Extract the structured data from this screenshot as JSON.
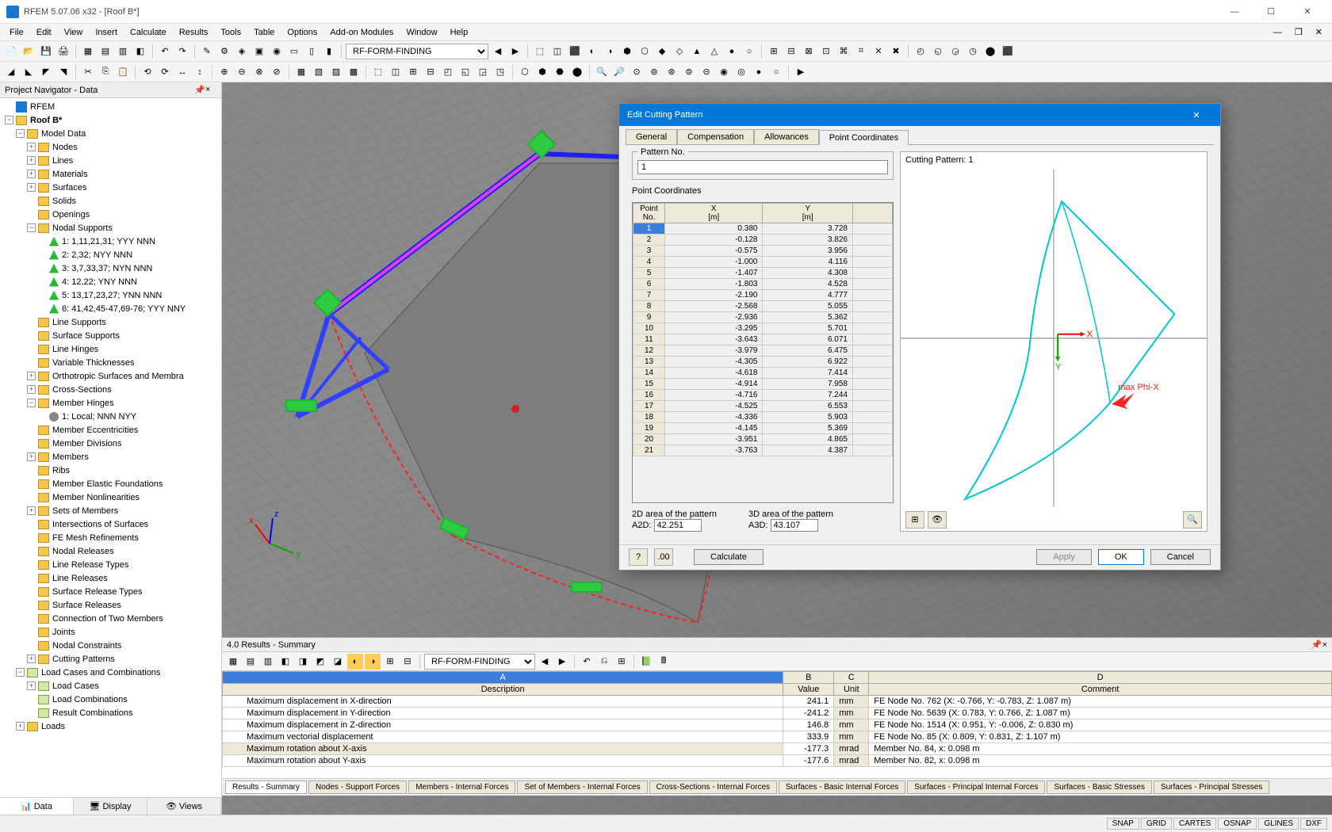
{
  "app": {
    "title": "RFEM 5.07.06 x32 - [Roof B*]"
  },
  "menu": [
    "File",
    "Edit",
    "View",
    "Insert",
    "Calculate",
    "Results",
    "Tools",
    "Table",
    "Options",
    "Add-on Modules",
    "Window",
    "Help"
  ],
  "toolbar_combo": "RF-FORM-FINDING",
  "navigator": {
    "title": "Project Navigator - Data",
    "root": "RFEM",
    "model": "Roof B*",
    "tabs": [
      "Data",
      "Display",
      "Views"
    ]
  },
  "tree": [
    {
      "l": 1,
      "exp": "-",
      "t": "Model Data",
      "folder": 1
    },
    {
      "l": 2,
      "exp": "+",
      "t": "Nodes",
      "folder": 1
    },
    {
      "l": 2,
      "exp": "+",
      "t": "Lines",
      "folder": 1
    },
    {
      "l": 2,
      "exp": "+",
      "t": "Materials",
      "folder": 1
    },
    {
      "l": 2,
      "exp": "+",
      "t": "Surfaces",
      "folder": 1
    },
    {
      "l": 2,
      "exp": "",
      "t": "Solids",
      "folder": 1
    },
    {
      "l": 2,
      "exp": "",
      "t": "Openings",
      "folder": 1
    },
    {
      "l": 2,
      "exp": "-",
      "t": "Nodal Supports",
      "folder": 1
    },
    {
      "l": 3,
      "exp": "",
      "t": "1: 1,11,21,31; YYY NNN",
      "icon": "support"
    },
    {
      "l": 3,
      "exp": "",
      "t": "2: 2,32; NYY NNN",
      "icon": "support"
    },
    {
      "l": 3,
      "exp": "",
      "t": "3: 3,7,33,37; NYN NNN",
      "icon": "support"
    },
    {
      "l": 3,
      "exp": "",
      "t": "4: 12,22; YNY NNN",
      "icon": "support"
    },
    {
      "l": 3,
      "exp": "",
      "t": "5: 13,17,23,27; YNN NNN",
      "icon": "support"
    },
    {
      "l": 3,
      "exp": "",
      "t": "6: 41,42,45-47,69-76; YYY NNY",
      "icon": "support"
    },
    {
      "l": 2,
      "exp": "",
      "t": "Line Supports",
      "folder": 1
    },
    {
      "l": 2,
      "exp": "",
      "t": "Surface Supports",
      "folder": 1
    },
    {
      "l": 2,
      "exp": "",
      "t": "Line Hinges",
      "folder": 1
    },
    {
      "l": 2,
      "exp": "",
      "t": "Variable Thicknesses",
      "folder": 1
    },
    {
      "l": 2,
      "exp": "+",
      "t": "Orthotropic Surfaces and Membra",
      "folder": 1
    },
    {
      "l": 2,
      "exp": "+",
      "t": "Cross-Sections",
      "folder": 1
    },
    {
      "l": 2,
      "exp": "-",
      "t": "Member Hinges",
      "folder": 1
    },
    {
      "l": 3,
      "exp": "",
      "t": "1: Local; NNN NYY",
      "icon": "hinge"
    },
    {
      "l": 2,
      "exp": "",
      "t": "Member Eccentricities",
      "folder": 1
    },
    {
      "l": 2,
      "exp": "",
      "t": "Member Divisions",
      "folder": 1
    },
    {
      "l": 2,
      "exp": "+",
      "t": "Members",
      "folder": 1
    },
    {
      "l": 2,
      "exp": "",
      "t": "Ribs",
      "folder": 1
    },
    {
      "l": 2,
      "exp": "",
      "t": "Member Elastic Foundations",
      "folder": 1
    },
    {
      "l": 2,
      "exp": "",
      "t": "Member Nonlinearities",
      "folder": 1
    },
    {
      "l": 2,
      "exp": "+",
      "t": "Sets of Members",
      "folder": 1
    },
    {
      "l": 2,
      "exp": "",
      "t": "Intersections of Surfaces",
      "folder": 1
    },
    {
      "l": 2,
      "exp": "",
      "t": "FE Mesh Refinements",
      "folder": 1
    },
    {
      "l": 2,
      "exp": "",
      "t": "Nodal Releases",
      "folder": 1
    },
    {
      "l": 2,
      "exp": "",
      "t": "Line Release Types",
      "folder": 1
    },
    {
      "l": 2,
      "exp": "",
      "t": "Line Releases",
      "folder": 1
    },
    {
      "l": 2,
      "exp": "",
      "t": "Surface Release Types",
      "folder": 1
    },
    {
      "l": 2,
      "exp": "",
      "t": "Surface Releases",
      "folder": 1
    },
    {
      "l": 2,
      "exp": "",
      "t": "Connection of Two Members",
      "folder": 1
    },
    {
      "l": 2,
      "exp": "",
      "t": "Joints",
      "folder": 1
    },
    {
      "l": 2,
      "exp": "",
      "t": "Nodal Constraints",
      "folder": 1
    },
    {
      "l": 2,
      "exp": "+",
      "t": "Cutting Patterns",
      "folder": 1
    },
    {
      "l": 1,
      "exp": "-",
      "t": "Load Cases and Combinations",
      "folder": 1,
      "special": 1
    },
    {
      "l": 2,
      "exp": "+",
      "t": "Load Cases",
      "folder": 1,
      "special": 1
    },
    {
      "l": 2,
      "exp": "",
      "t": "Load Combinations",
      "folder": 1,
      "special": 1
    },
    {
      "l": 2,
      "exp": "",
      "t": "Result Combinations",
      "folder": 1,
      "special": 1
    },
    {
      "l": 1,
      "exp": "+",
      "t": "Loads",
      "folder": 1
    }
  ],
  "results": {
    "title": "4.0 Results - Summary",
    "combo": "RF-FORM-FINDING",
    "cols": {
      "a": "A",
      "b": "B",
      "c": "C",
      "d": "D"
    },
    "headers": {
      "desc": "Description",
      "val": "Value",
      "unit": "Unit",
      "comment": "Comment"
    },
    "rows": [
      {
        "desc": "Maximum displacement in X-direction",
        "val": "241.1",
        "unit": "mm",
        "comment": "FE Node No. 762 (X: -0.766,  Y: -0.783,  Z: 1.087 m)"
      },
      {
        "desc": "Maximum displacement in Y-direction",
        "val": "-241.2",
        "unit": "mm",
        "comment": "FE Node No. 5639 (X: 0.783,  Y: 0.766,  Z: 1.087 m)"
      },
      {
        "desc": "Maximum displacement in Z-direction",
        "val": "146.8",
        "unit": "mm",
        "comment": "FE Node No. 1514 (X: 0.951,  Y: -0.006,  Z: 0.830 m)"
      },
      {
        "desc": "Maximum vectorial displacement",
        "val": "333.9",
        "unit": "mm",
        "comment": "FE Node No. 85 (X: 0.809,  Y: 0.831,  Z: 1.107 m)"
      },
      {
        "desc": "Maximum rotation about X-axis",
        "val": "-177.3",
        "unit": "mrad",
        "comment": "Member No. 84,  x: 0.098 m",
        "sel": 1
      },
      {
        "desc": "Maximum rotation about Y-axis",
        "val": "-177.6",
        "unit": "mrad",
        "comment": "Member No. 82,  x: 0.098 m"
      }
    ],
    "tabs": [
      "Results - Summary",
      "Nodes - Support Forces",
      "Members - Internal Forces",
      "Set of Members - Internal Forces",
      "Cross-Sections - Internal Forces",
      "Surfaces - Basic Internal Forces",
      "Surfaces - Principal Internal Forces",
      "Surfaces - Basic Stresses",
      "Surfaces - Principal Stresses"
    ]
  },
  "status": [
    "SNAP",
    "GRID",
    "CARTES",
    "OSNAP",
    "GLINES",
    "DXF"
  ],
  "dialog": {
    "title": "Edit Cutting Pattern",
    "tabs": [
      "General",
      "Compensation",
      "Allowances",
      "Point Coordinates"
    ],
    "active_tab": 3,
    "pattern_label": "Pattern No.",
    "pattern_no": "1",
    "coords_label": "Point Coordinates",
    "col_headers": {
      "pn": "Point\nNo.",
      "x": "X\n[m]",
      "y": "Y\n[m]"
    },
    "points": [
      {
        "n": 1,
        "x": "0.380",
        "y": "3.728",
        "sel": 1
      },
      {
        "n": 2,
        "x": "-0.128",
        "y": "3.826"
      },
      {
        "n": 3,
        "x": "-0.575",
        "y": "3.956"
      },
      {
        "n": 4,
        "x": "-1.000",
        "y": "4.116"
      },
      {
        "n": 5,
        "x": "-1.407",
        "y": "4.308"
      },
      {
        "n": 6,
        "x": "-1.803",
        "y": "4.528"
      },
      {
        "n": 7,
        "x": "-2.190",
        "y": "4.777"
      },
      {
        "n": 8,
        "x": "-2.568",
        "y": "5.055"
      },
      {
        "n": 9,
        "x": "-2.936",
        "y": "5.362"
      },
      {
        "n": 10,
        "x": "-3.295",
        "y": "5.701"
      },
      {
        "n": 11,
        "x": "-3.643",
        "y": "6.071"
      },
      {
        "n": 12,
        "x": "-3.979",
        "y": "6.475"
      },
      {
        "n": 13,
        "x": "-4.305",
        "y": "6.922"
      },
      {
        "n": 14,
        "x": "-4.618",
        "y": "7.414"
      },
      {
        "n": 15,
        "x": "-4.914",
        "y": "7.958"
      },
      {
        "n": 16,
        "x": "-4.716",
        "y": "7.244"
      },
      {
        "n": 17,
        "x": "-4.525",
        "y": "6.553"
      },
      {
        "n": 18,
        "x": "-4.336",
        "y": "5.903"
      },
      {
        "n": 19,
        "x": "-4.145",
        "y": "5.369"
      },
      {
        "n": 20,
        "x": "-3.951",
        "y": "4.865"
      },
      {
        "n": 21,
        "x": "-3.763",
        "y": "4.387"
      }
    ],
    "area2d_label": "2D area of the pattern",
    "area2d_sym": "A2D:",
    "area2d": "42.251",
    "area3d_label": "3D area of the pattern",
    "area3d_sym": "A3D:",
    "area3d": "43.107",
    "preview_label": "Cutting Pattern: 1",
    "annotation": "max Phi-X",
    "axis_x": "X",
    "axis_y": "Y",
    "buttons": {
      "calc": "Calculate",
      "apply": "Apply",
      "ok": "OK",
      "cancel": "Cancel"
    }
  }
}
